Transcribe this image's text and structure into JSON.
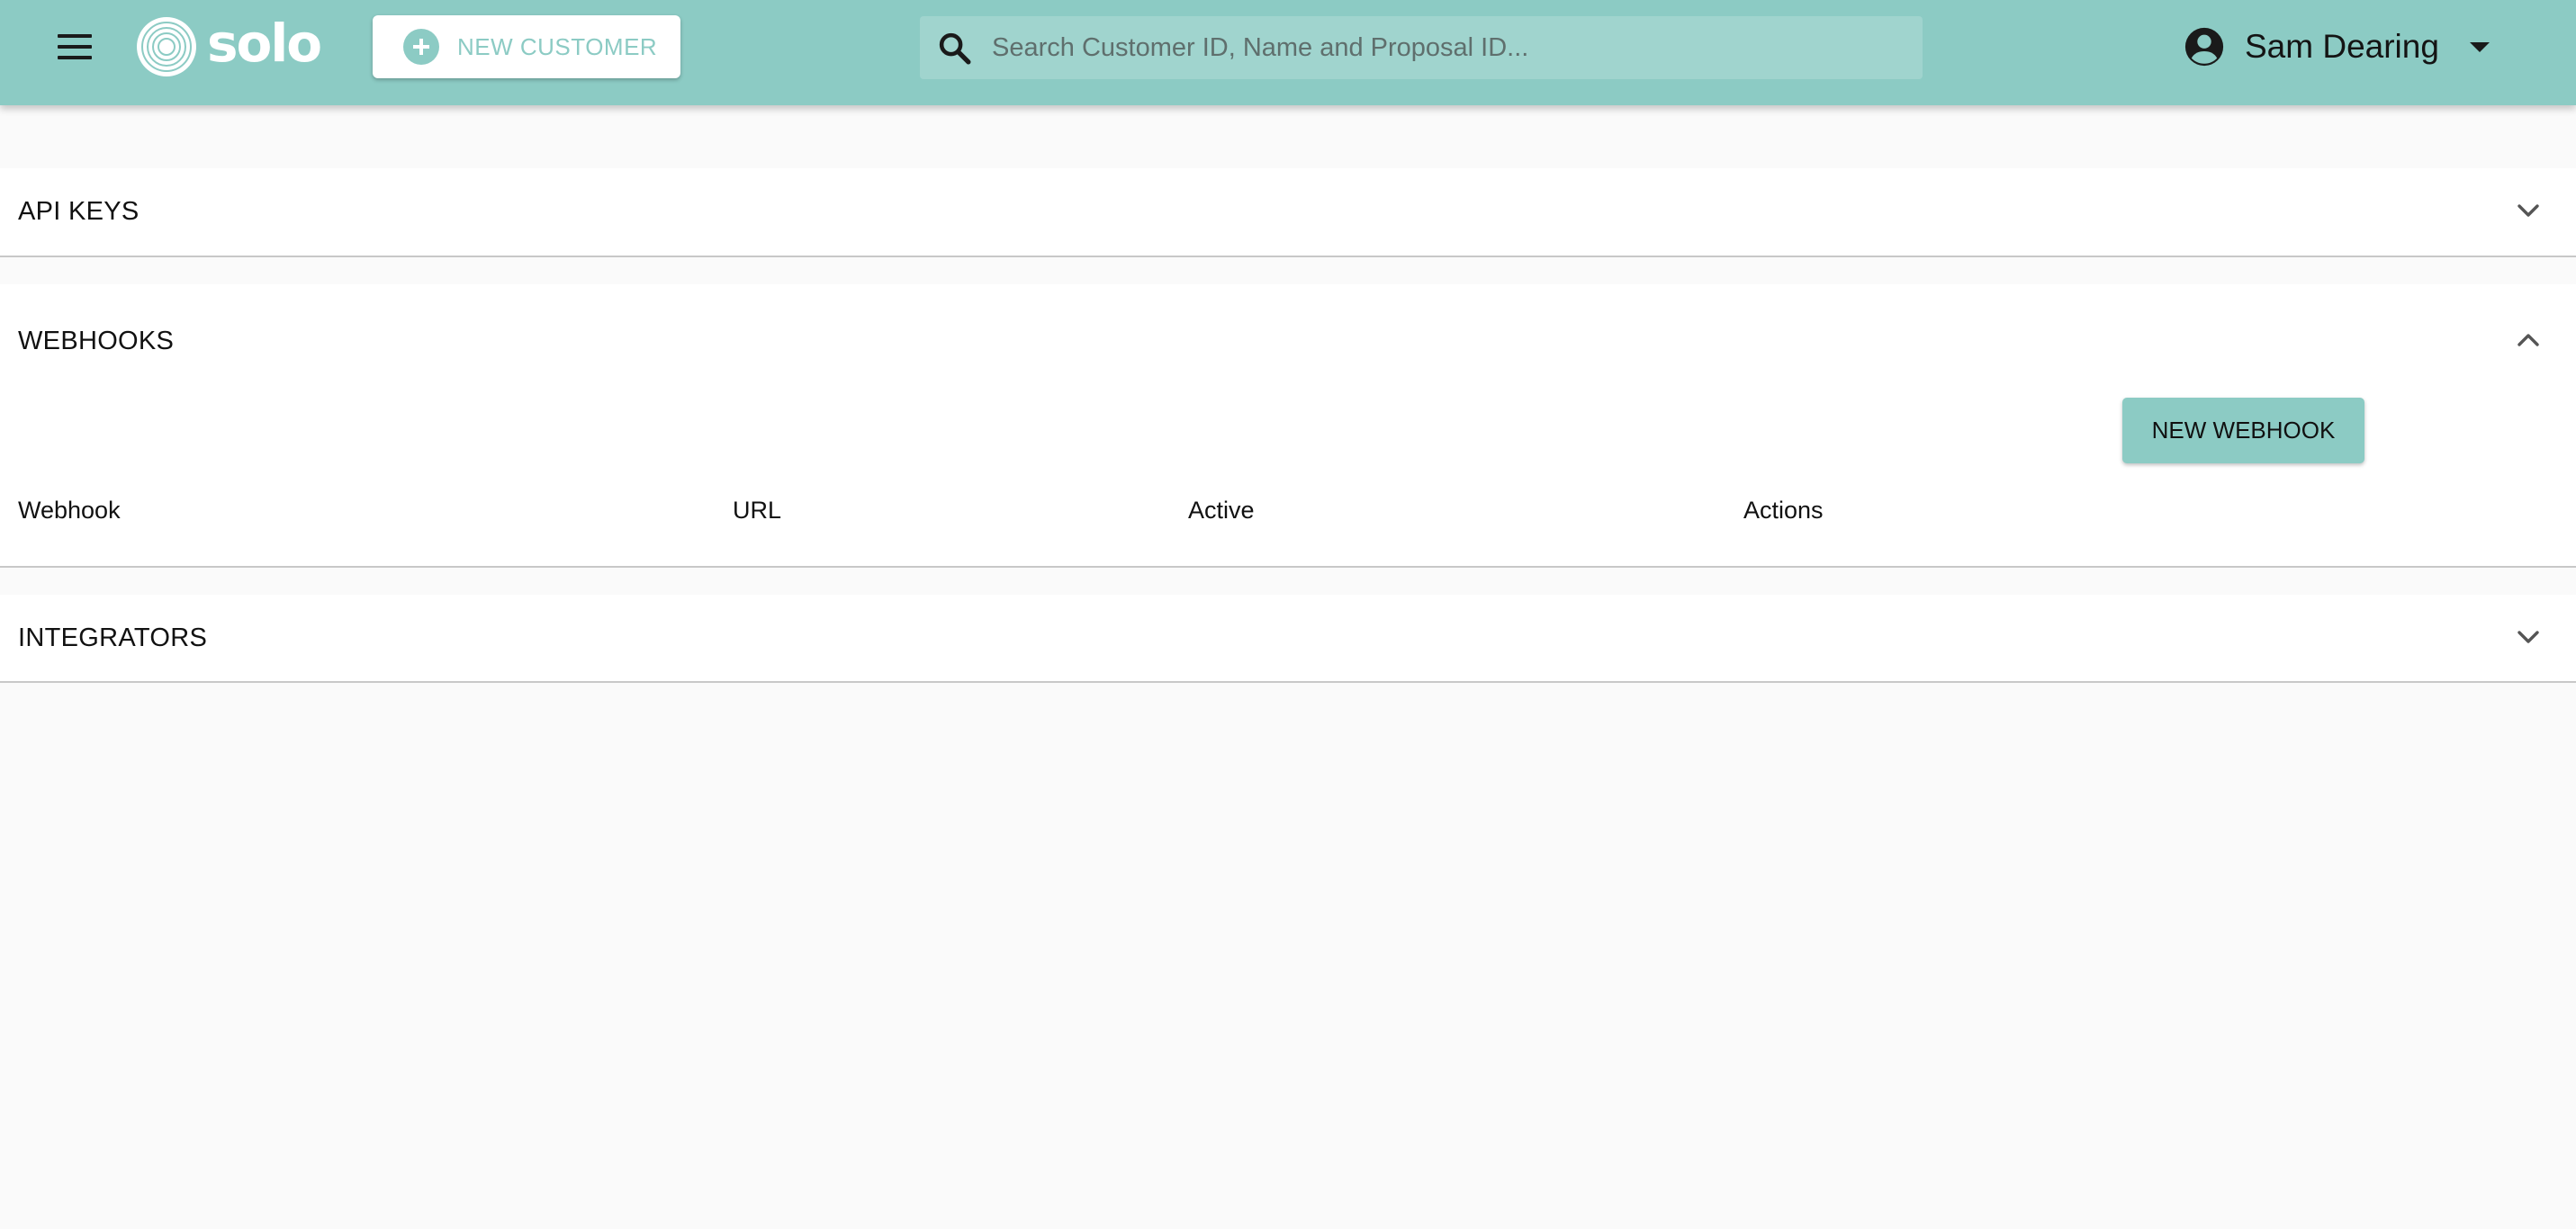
{
  "header": {
    "logo_text": "solo",
    "new_customer_label": "NEW CUSTOMER",
    "search_placeholder": "Search Customer ID, Name and Proposal ID...",
    "user_name": "Sam Dearing"
  },
  "panels": {
    "api_keys": {
      "title": "API KEYS",
      "expanded": false
    },
    "webhooks": {
      "title": "WEBHOOKS",
      "expanded": true,
      "new_webhook_label": "NEW WEBHOOK",
      "columns": [
        "Webhook",
        "URL",
        "Active",
        "Actions"
      ]
    },
    "integrators": {
      "title": "INTEGRATORS",
      "expanded": false
    }
  },
  "colors": {
    "brand": "#8ccbc4",
    "search_bg": "#a0d4ce",
    "page_bg": "#fafafa"
  },
  "icons": [
    "menu-icon",
    "solo-logo-icon",
    "add-circle-icon",
    "search-icon",
    "account-circle-icon",
    "caret-down-icon",
    "chevron-down-icon",
    "chevron-up-icon"
  ]
}
